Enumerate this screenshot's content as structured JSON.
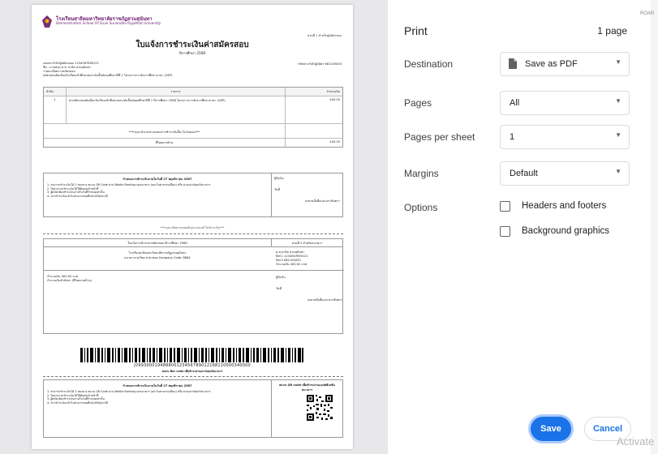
{
  "document": {
    "school_th": "โรงเรียนสาธิตมหาวิทยาลัยราชภัฏสวนสุนันทา",
    "school_en": "Demonstration School Of Suan Sunandha Rajabhat University",
    "copy_label": "ส่วนที่ 1 สำหรับผู้สมัครสอบ",
    "title": "ใบแจ้งการชำระเงินค่าสมัครสอบ",
    "subtitle": "ปีการศึกษา 2568",
    "ref_line": "เลขประจำตัวผู้สมัครสอบ 1234567890121",
    "name_line": "ชื่อ - นามสกุล ด.ช. สาธิต สวนสุนันทา",
    "apply_line": "รายละเอียดการสมัครสอบ",
    "program_line": "สมัครสอบคัดเลือกนักเรียนเข้าศึกษาต่อระดับชั้นมัธยมศึกษาปีที่ 1 โครงการการจัดการศึกษาภาษา (GEP)",
    "ref_right": "รหัสประจำตัวผู้สมัคร 681100003",
    "table_headers": [
      "ลำดับ",
      "รายการ",
      "จำนวนเงิน"
    ],
    "table_row": {
      "no": "1",
      "desc": "ค่าสมัครสอบคัดเลือกนักเรียนเข้าศึกษาต่อระดับชั้นมัธยมศึกษาปีที่ 1 ปีการศึกษา 2568 โครงการการจัดการศึกษาภาษา (GEP)",
      "amount": "400.00"
    },
    "table_note": "***กรุณานำเอกสารแสดงการชำระเงินนี้มาในวันสอบ***",
    "total_label": "สี่ร้อยบาทถ้วน",
    "total_amount": "400.00",
    "deadline": "กำหนดการชำระเงินภายในวันที่ 27 พฤศจิกายน 2567",
    "instruction_1": "1. สามารถชำระเงินได้ 2 ช่องทาง สแกน QR Code ผ่าน Mobile Banking ทุกธนาคาร (ยกเว้นค่าธรรมเนียม) หรือ ผ่านเคาน์เตอร์ธนาคาร",
    "instruction_2": "2. ไม่สามารถชำระเงินได้ให้ติดต่อเจ้าหน้าที่",
    "instruction_3": "3. ผู้สมัครต้องชำระเงินภายในวันที่กำหนดเท่านั้น",
    "instruction_4": "4. หากชำระเงินแล้วไม่สามารถขอคืนเงินได้ทุกกรณี",
    "receiver_label": "ผู้รับเงิน",
    "date_label": "วันที่",
    "sign_label": "ลงลายมือชื่อและประทับตรา",
    "cut_note": "***กรุณาตัดตามรอยเส้นประก่อนนำไปชำระเงิน***",
    "bank_copy_left": "ใบแจ้งการชำระค่าสมัครสอบ ปีการศึกษา 2568",
    "bank_copy_right": "ส่วนที่ 2 สำหรับธนาคาร",
    "bank_school": "โรงเรียนสาธิตมหาวิทยาลัยราชภัฏสวนสุนันทา",
    "bank_company": "ธนาคารกรุงไทย สาขาย่อย Company Code: 8884",
    "bank_name": "ด.ช.สาธิต สวนสุนันทา",
    "ref1": "Ref.1 1234567890121",
    "ref2": "Ref.2 681100003",
    "amount_line": "จำนวนเงิน 400.00 บาท",
    "amount_text": "จำนวนเงิน 400.00 บาท",
    "amount_words": "จำนวนเงินตัวอักษร (สี่ร้อยบาทถ้วน)",
    "barcode_number": "|099300019488800123456789012168110000340000",
    "barcode_caption": "สแกน Bar code เพื่อชำระผ่านเคาน์เตอร์ธนาคาร",
    "qr_caption": "สแกน QR code เพื่อชำระผ่านแอปพลิเคชันธนาคาร"
  },
  "settings": {
    "title": "Print",
    "page_count": "1 page",
    "destination": {
      "label": "Destination",
      "value": "Save as PDF"
    },
    "pages": {
      "label": "Pages",
      "value": "All"
    },
    "pages_per_sheet": {
      "label": "Pages per sheet",
      "value": "1"
    },
    "margins": {
      "label": "Margins",
      "value": "Default"
    },
    "options": {
      "label": "Options",
      "headers_footers": "Headers and footers",
      "background_graphics": "Background graphics"
    },
    "save_label": "Save",
    "cancel_label": "Cancel"
  },
  "edge_text": "ROAR",
  "watermark": "Activate"
}
